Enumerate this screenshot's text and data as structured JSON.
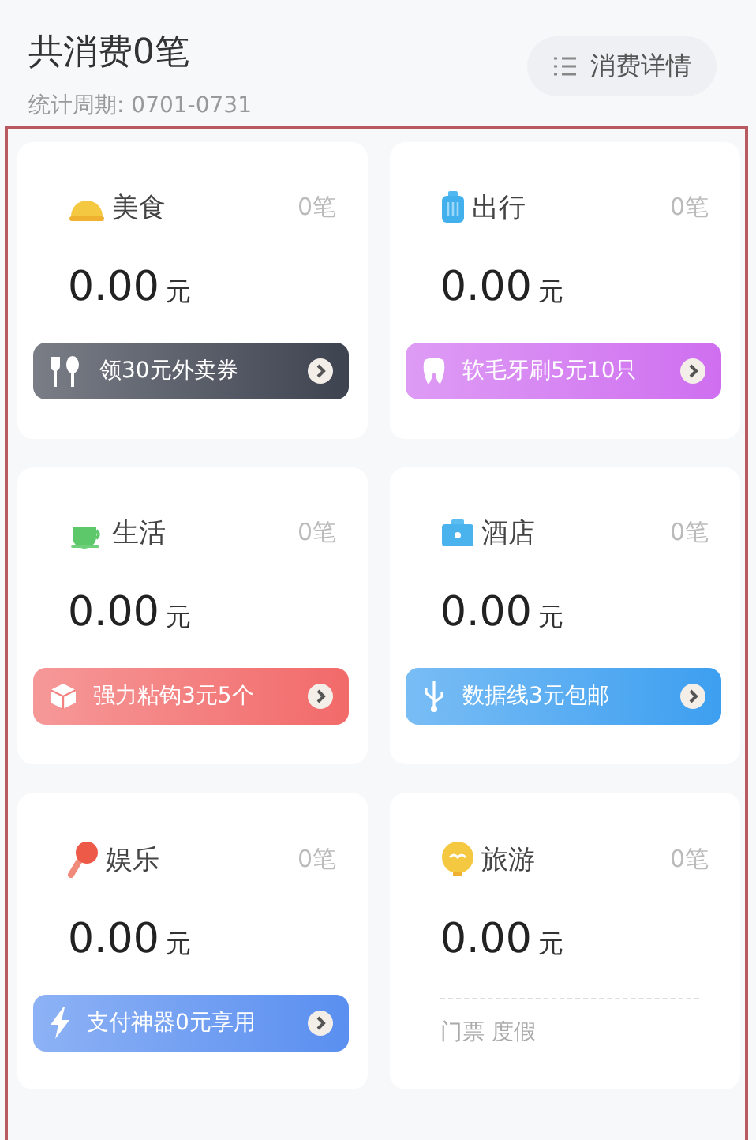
{
  "header": {
    "title": "共消费0笔",
    "period": "统计周期: 0701-0731",
    "details_button": "消费详情"
  },
  "categories": [
    {
      "name": "美食",
      "count": "0笔",
      "amount": "0.00",
      "unit": "元",
      "kind": "promo",
      "promo": "领30元外卖券",
      "color": "#3e4350"
    },
    {
      "name": "出行",
      "count": "0笔",
      "amount": "0.00",
      "unit": "元",
      "kind": "promo",
      "promo": "软毛牙刷5元10只",
      "color": "#cf6ff0"
    },
    {
      "name": "生活",
      "count": "0笔",
      "amount": "0.00",
      "unit": "元",
      "kind": "promo",
      "promo": "强力粘钩3元5个",
      "color": "#f26a6a"
    },
    {
      "name": "酒店",
      "count": "0笔",
      "amount": "0.00",
      "unit": "元",
      "kind": "promo",
      "promo": "数据线3元包邮",
      "color": "#3d9ff0"
    },
    {
      "name": "娱乐",
      "count": "0笔",
      "amount": "0.00",
      "unit": "元",
      "kind": "promo",
      "promo": "支付神器0元享用",
      "color": "#5a8ff0"
    },
    {
      "name": "旅游",
      "count": "0笔",
      "amount": "0.00",
      "unit": "元",
      "kind": "tags",
      "tags": "门票 度假"
    }
  ]
}
